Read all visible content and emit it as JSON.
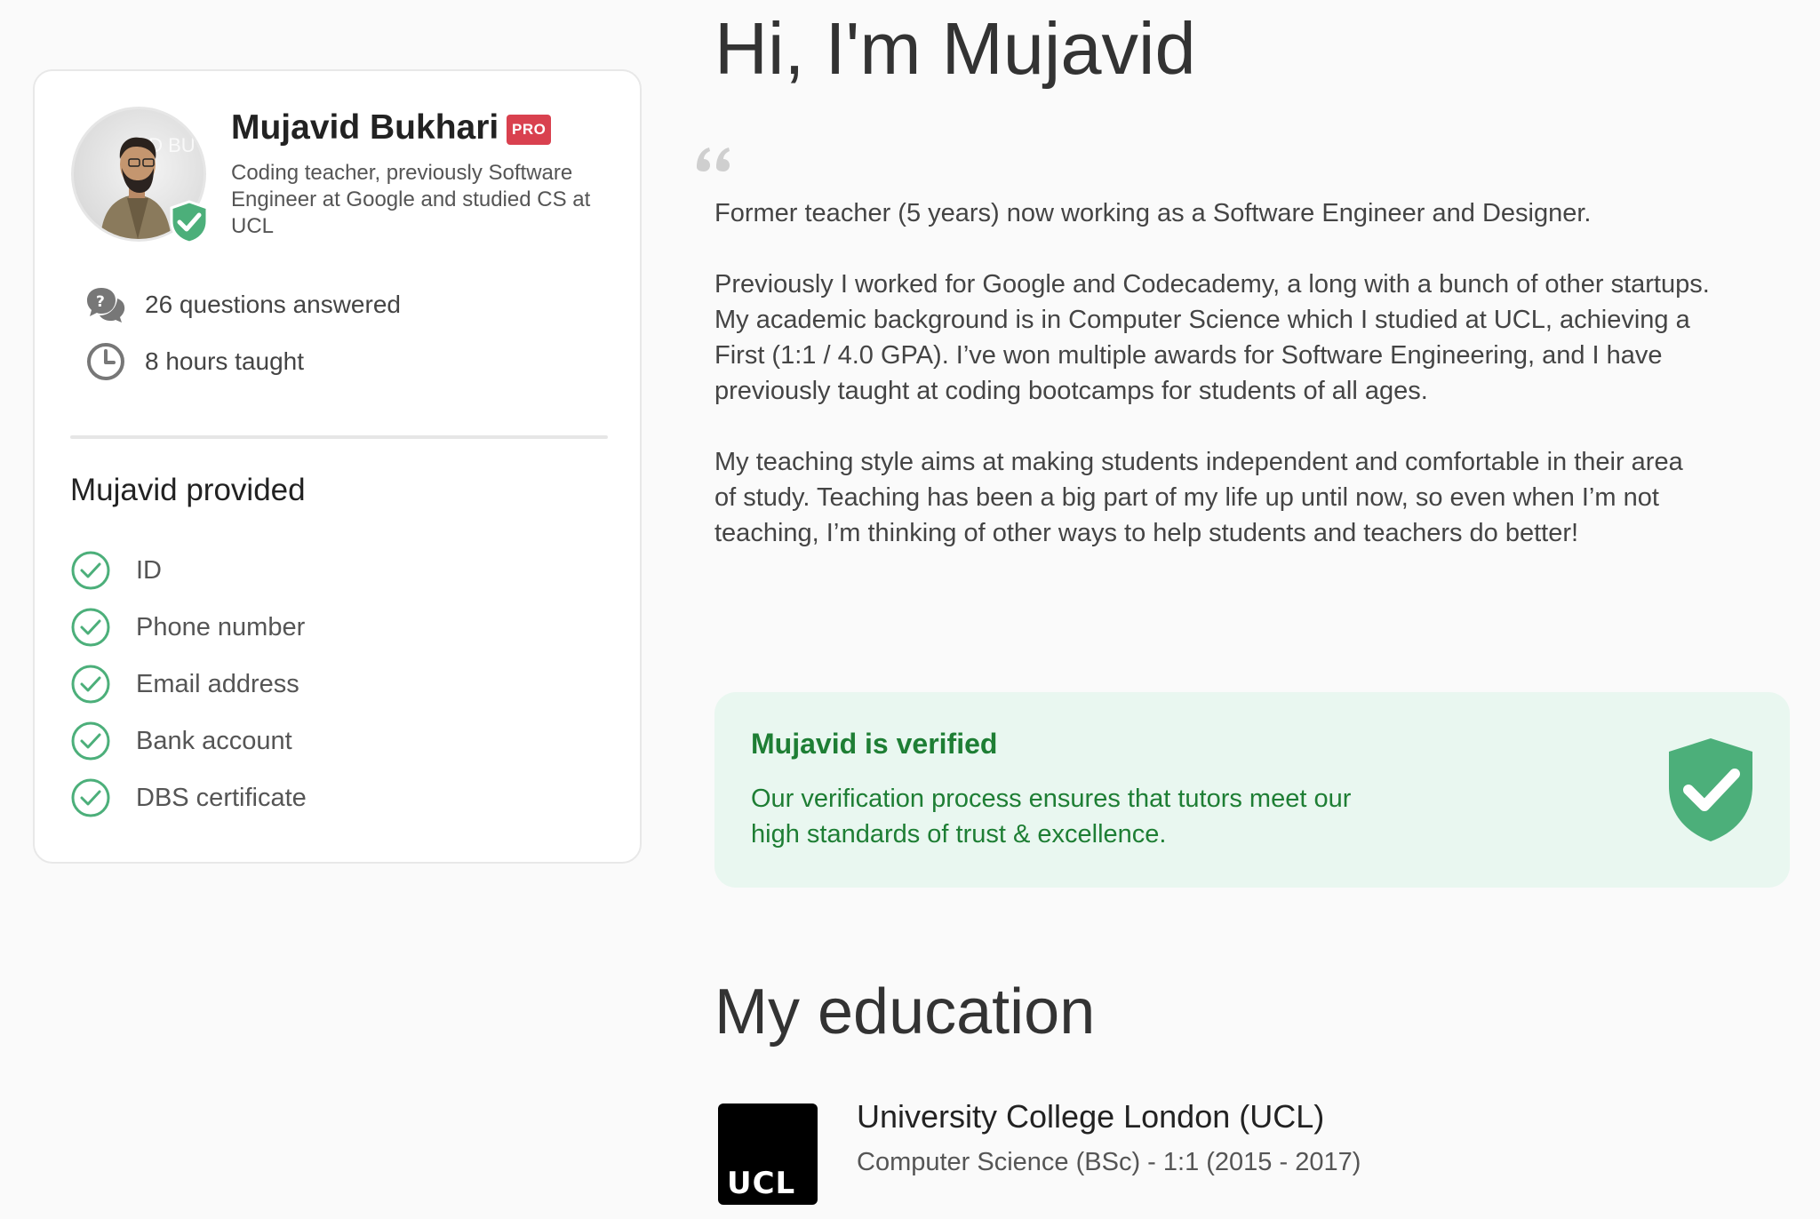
{
  "profile_card": {
    "name": "Mujavid Bukhari",
    "badge": "PRO",
    "bio": "Coding teacher, previously Software Engineer at Google and studied CS at UCL",
    "avatar_watermark": "ID BU",
    "stats": [
      {
        "icon": "questions-icon",
        "label": "26 questions answered"
      },
      {
        "icon": "clock-icon",
        "label": "8 hours taught"
      }
    ],
    "provided_heading": "Mujavid provided",
    "provided_items": [
      "ID",
      "Phone number",
      "Email address",
      "Bank account",
      "DBS certificate"
    ]
  },
  "main": {
    "greeting": "Hi, I'm Mujavid",
    "about": [
      "Former teacher (5 years) now working as a Software Engineer and Designer.",
      "Previously I worked for Google and Codecademy, a long with a bunch of other startups. My academic background is in Computer Science which I studied at UCL, achieving a First (1:1 / 4.0 GPA). I’ve won multiple awards for Software Engineering, and I have previously taught at coding bootcamps for students of all ages.",
      "My teaching style aims at making students independent and comfortable in their area of study. Teaching has been a big part of my life up until now, so even when I’m not teaching, I’m thinking of other ways to help students and teachers do better!"
    ],
    "verified": {
      "title": "Mujavid is verified",
      "text": "Our verification process ensures that tutors meet our high standards of trust & excellence."
    },
    "education": {
      "heading": "My education",
      "logo_text": "UCL",
      "school": "University College London (UCL)",
      "degree": "Computer Science (BSc) - 1:1 (2015 - 2017)"
    }
  },
  "colors": {
    "accent_green": "#1e7e34",
    "check_green": "#4caf7a",
    "badge_red": "#d9414f",
    "verified_bg": "#e9f7f0"
  }
}
